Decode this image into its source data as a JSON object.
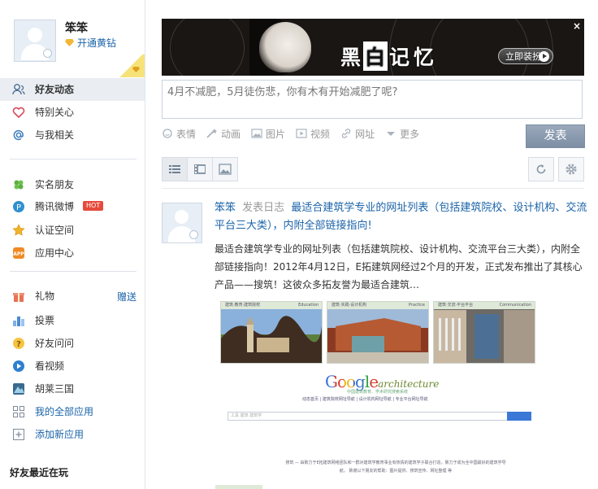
{
  "user": {
    "name": "笨笨",
    "vip_link": "开通黄钻"
  },
  "nav": {
    "primary": [
      {
        "label": "好友动态",
        "icon": "feed-icon",
        "active": true
      },
      {
        "label": "特别关心",
        "icon": "heart-icon"
      },
      {
        "label": "与我相关",
        "icon": "at-icon"
      }
    ],
    "apps": [
      {
        "label": "实名朋友",
        "icon": "clover-icon"
      },
      {
        "label": "腾讯微博",
        "icon": "weibo-icon",
        "badge": "HOT"
      },
      {
        "label": "认证空间",
        "icon": "star-icon"
      },
      {
        "label": "应用中心",
        "icon": "app-icon"
      }
    ],
    "tools": [
      {
        "label": "礼物",
        "icon": "gift-icon",
        "extra": "赠送"
      },
      {
        "label": "投票",
        "icon": "vote-icon"
      },
      {
        "label": "好友问问",
        "icon": "question-icon"
      },
      {
        "label": "看视频",
        "icon": "video-icon"
      },
      {
        "label": "胡莱三国",
        "icon": "game-icon"
      },
      {
        "label": "我的全部应用",
        "icon": "grid-icon",
        "link": true
      },
      {
        "label": "添加新应用",
        "icon": "plus-icon",
        "link": true
      }
    ],
    "recent_title": "好友最近在玩"
  },
  "banner": {
    "title_chars": [
      "黑",
      "白",
      "记",
      "忆"
    ],
    "button": "立即装扮",
    "close": "×"
  },
  "composer": {
    "placeholder": "4月不减肥，5月徒伤悲，你有木有开始减肥了呢?",
    "tools": [
      "表情",
      "动画",
      "图片",
      "视频",
      "网址",
      "更多"
    ],
    "submit": "发表"
  },
  "feed": {
    "author": "笨笨",
    "action": "发表日志",
    "title": "最适合建筑学专业的网址列表（包括建筑院校、设计机构、交流平台三大类），内附全部链接指向!",
    "summary": "最适合建筑学专业的网址列表（包括建筑院校、设计机构、交流平台三大类），内附全部链接指向！2012年4月12日，E拓建筑网经过2个月的开发，正式发布推出了其核心产品——搜筑！这彼众多拓友誉为最适合建筑…",
    "thumbs": [
      {
        "cap": "建筑·教育·建筑院校",
        "tag": "Education"
      },
      {
        "cap": "建筑·实践·设计机构",
        "tag": "Practice"
      },
      {
        "cap": "建筑·交流·平台平台",
        "tag": "Communication"
      }
    ],
    "logo_word": "Google",
    "logo_sub": "architecture",
    "logo_tagline": "中国建筑教育、学术研究搜索系统",
    "links_line": "动态首页 | 建筑院校网址导航 | 设计机构网址导航 | 专业平台网址导航",
    "search_placeholder": "工具 建筑 建筑学",
    "footer": "搜筑 — 由致力于E拓建筑网络团队和一群对建筑学教育事业有热情的建筑学子联合打造，致力于成为全中国最好的建筑学导航。 致谢以下朋友的帮助：图片提供、搜筑宣传、网址整理 等"
  }
}
